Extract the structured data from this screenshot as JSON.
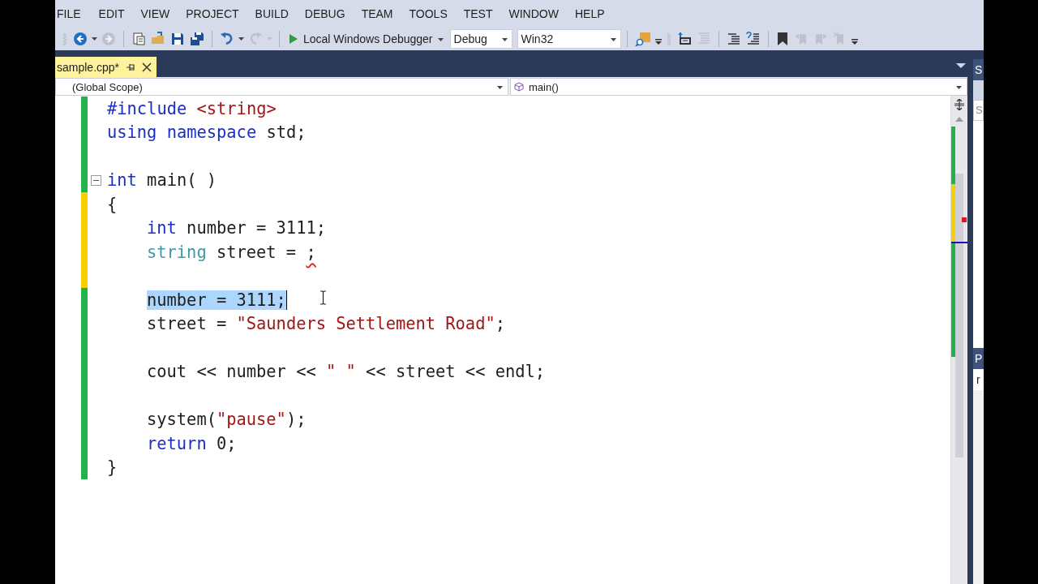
{
  "menu": [
    "FILE",
    "EDIT",
    "VIEW",
    "PROJECT",
    "BUILD",
    "DEBUG",
    "TEAM",
    "TOOLS",
    "TEST",
    "WINDOW",
    "HELP"
  ],
  "toolbar": [
    {
      "kind": "grip"
    },
    {
      "kind": "back",
      "disabled": false
    },
    {
      "kind": "caret",
      "disabled": false
    },
    {
      "kind": "forward",
      "disabled": true
    },
    {
      "kind": "separator"
    },
    {
      "kind": "new",
      "disabled": false
    },
    {
      "kind": "open",
      "disabled": false
    },
    {
      "kind": "save",
      "disabled": false
    },
    {
      "kind": "saveall",
      "disabled": false
    },
    {
      "kind": "separator"
    },
    {
      "kind": "undo",
      "disabled": false
    },
    {
      "kind": "caret",
      "disabled": false
    },
    {
      "kind": "redo",
      "disabled": true
    },
    {
      "kind": "caret",
      "disabled": true
    },
    {
      "kind": "separator"
    },
    {
      "kind": "run",
      "label": "Local Windows Debugger",
      "disabled": false
    },
    {
      "kind": "combo",
      "value": "Debug",
      "disabled": false
    },
    {
      "kind": "combo",
      "value": "Win32",
      "disabled": false
    },
    {
      "kind": "separator"
    },
    {
      "kind": "find",
      "disabled": false
    },
    {
      "kind": "overflow"
    },
    {
      "kind": "grip"
    },
    {
      "kind": "indent",
      "disabled": false
    },
    {
      "kind": "unindent",
      "disabled": true
    },
    {
      "kind": "separator"
    },
    {
      "kind": "comment",
      "disabled": false
    },
    {
      "kind": "uncomment",
      "disabled": false
    },
    {
      "kind": "separator"
    },
    {
      "kind": "bookmark",
      "disabled": false
    },
    {
      "kind": "bookmark-prev",
      "disabled": true
    },
    {
      "kind": "bookmark-next",
      "disabled": true
    },
    {
      "kind": "bookmark-clear",
      "disabled": true
    },
    {
      "kind": "overflow"
    }
  ],
  "tab": {
    "title": "sample.cpp*",
    "selected": true
  },
  "navigation": {
    "scope": "(Global Scope)",
    "member": "main()"
  },
  "lines": [
    {
      "color": "#22b14c",
      "indented": false,
      "fold": false,
      "caret": false,
      "tokens": [
        {
          "kind": "preprocessor",
          "text": "#include "
        },
        {
          "kind": "include_path",
          "text": "<string>"
        }
      ]
    },
    {
      "color": "#22b14c",
      "indented": false,
      "fold": false,
      "caret": false,
      "tokens": [
        {
          "kind": "keyword",
          "text": "using "
        },
        {
          "kind": "keyword",
          "text": "namespace "
        },
        {
          "kind": "plain",
          "text": "std;"
        }
      ]
    },
    {
      "color": "#22b14c",
      "fold": false,
      "caret": false
    },
    {
      "color": "#22b14c",
      "indented": false,
      "fold": true,
      "caret": false,
      "tokens": [
        {
          "kind": "keyword",
          "text": "int "
        },
        {
          "kind": "plain",
          "text": "main( )"
        }
      ]
    },
    {
      "color": "#f5d000",
      "indented": false,
      "fold": false,
      "caret": false,
      "tokens": [
        {
          "kind": "plain",
          "text": "{"
        }
      ]
    },
    {
      "color": "#f5d000",
      "indented": true,
      "fold": false,
      "caret": false,
      "tokens": [
        {
          "kind": "keyword",
          "text": "int "
        },
        {
          "kind": "plain",
          "text": "number = 3111;"
        }
      ]
    },
    {
      "color": "#f5d000",
      "indented": true,
      "fold": false,
      "caret": false,
      "tokens": [
        {
          "kind": "type",
          "text": "string "
        },
        {
          "kind": "plain",
          "text": "street = "
        },
        {
          "kind": "error",
          "text": ";"
        }
      ]
    },
    {
      "color": "#f5d000",
      "fold": false,
      "caret": false
    },
    {
      "color": "#22b14c",
      "indented": true,
      "fold": false,
      "caret": true,
      "tokens": [
        {
          "kind": "selection",
          "text": "number = 3111;"
        }
      ]
    },
    {
      "color": "#22b14c",
      "indented": true,
      "fold": false,
      "caret": false,
      "tokens": [
        {
          "kind": "plain",
          "text": "street = "
        },
        {
          "kind": "string",
          "text": "\"Saunders Settlement Road\""
        },
        {
          "kind": "plain",
          "text": ";"
        }
      ]
    },
    {
      "color": "#22b14c",
      "fold": false,
      "caret": false
    },
    {
      "color": "#22b14c",
      "indented": true,
      "fold": false,
      "caret": false,
      "tokens": [
        {
          "kind": "plain",
          "text": "cout << number << "
        },
        {
          "kind": "string",
          "text": "\" \""
        },
        {
          "kind": "plain",
          "text": " << street << endl;"
        }
      ]
    },
    {
      "color": "#22b14c",
      "fold": false,
      "caret": false
    },
    {
      "color": "#22b14c",
      "indented": true,
      "fold": false,
      "caret": false,
      "tokens": [
        {
          "kind": "plain",
          "text": "system("
        },
        {
          "kind": "string",
          "text": "\"pause\""
        },
        {
          "kind": "plain",
          "text": ");"
        }
      ]
    },
    {
      "color": "#22b14c",
      "indented": true,
      "fold": false,
      "caret": false,
      "tokens": [
        {
          "kind": "keyword",
          "text": "return "
        },
        {
          "kind": "plain",
          "text": "0;"
        }
      ]
    },
    {
      "color": "#22b14c",
      "indented": false,
      "fold": false,
      "caret": false,
      "tokens": [
        {
          "kind": "plain",
          "text": "}"
        }
      ]
    }
  ],
  "side_panel": {
    "top_title": "S",
    "search_placeholder": "S",
    "bottom_title": "P",
    "item": "r"
  }
}
